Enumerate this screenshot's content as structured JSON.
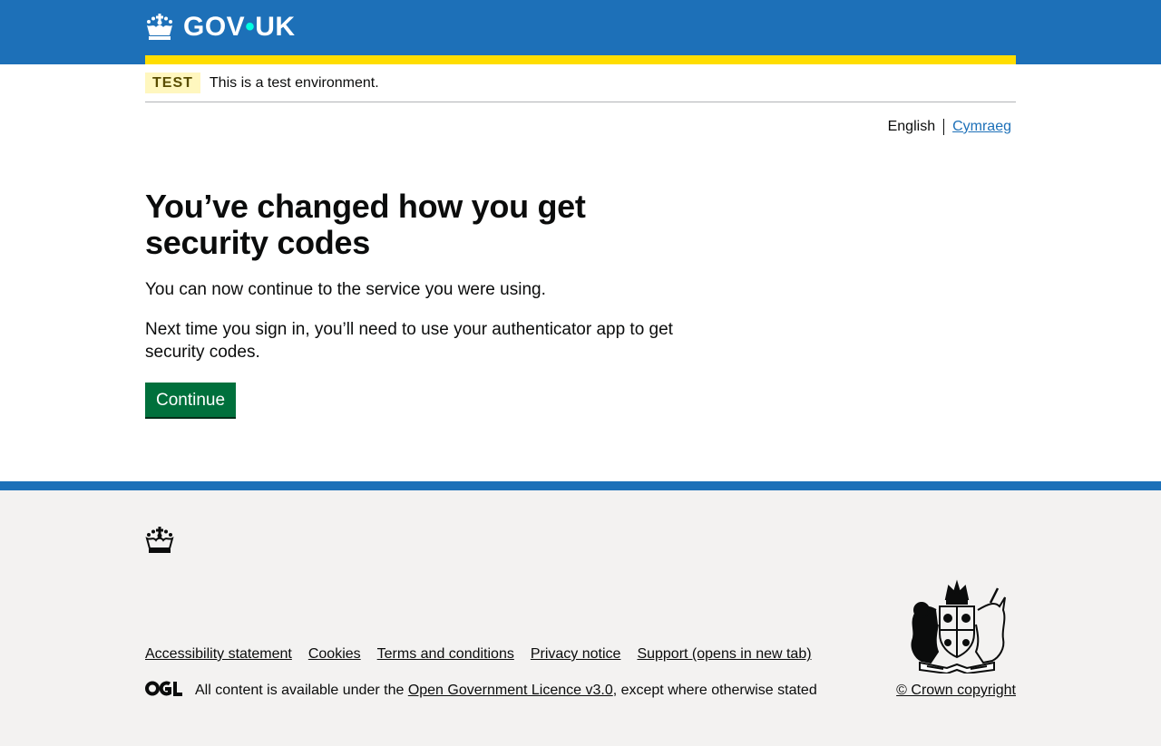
{
  "header": {
    "logo_text_left": "GOV",
    "logo_dot": "•",
    "logo_text_right": "UK",
    "logo_icon": "crown-icon",
    "brand_color": "#1d70b8",
    "accent_color": "#ffdd00"
  },
  "phase_banner": {
    "tag": "TEST",
    "text": "This is a test environment."
  },
  "language_toggle": {
    "current": "English",
    "other": "Cymraeg"
  },
  "main": {
    "heading": "You’ve changed how you get security codes",
    "paragraph_1": "You can now continue to the service you were using.",
    "paragraph_2": "Next time you sign in, you’ll need to use your authenticator app to get security codes.",
    "continue_button": "Continue",
    "button_color": "#00703c"
  },
  "footer": {
    "links": [
      "Accessibility statement",
      "Cookies",
      "Terms and conditions",
      "Privacy notice",
      "Support (opens in new tab)"
    ],
    "licence_prefix": "All content is available under the ",
    "licence_link": "Open Government Licence v3.0",
    "licence_suffix": ", except where otherwise stated",
    "copyright": "© Crown copyright",
    "ogl_logo": "OGL",
    "crest_icon": "royal-coat-of-arms-icon"
  }
}
